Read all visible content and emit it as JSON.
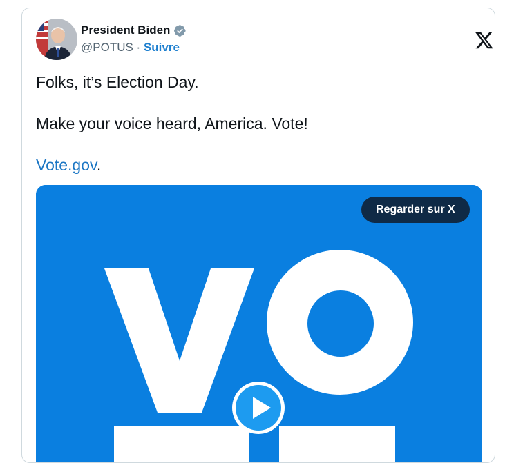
{
  "author": {
    "display_name": "President Biden",
    "handle": "@POTUS",
    "separator": " · ",
    "follow_label": "Suivre",
    "verified_icon": "verified-badge-icon",
    "verified_color": "#829aab"
  },
  "platform": {
    "logo": "x-logo-icon"
  },
  "tweet": {
    "line1": "Folks, it’s Election Day.",
    "line2": "Make your voice heard, America. Vote!",
    "link_text": "Vote.gov",
    "link_suffix": "."
  },
  "media": {
    "background_color": "#0a7fe0",
    "visible_letters": "VO",
    "watch_button_label": "Regarder sur X",
    "play_icon": "play-icon"
  },
  "colors": {
    "accent": "#1d7fcf",
    "text": "#0f1419",
    "muted": "#536471"
  }
}
